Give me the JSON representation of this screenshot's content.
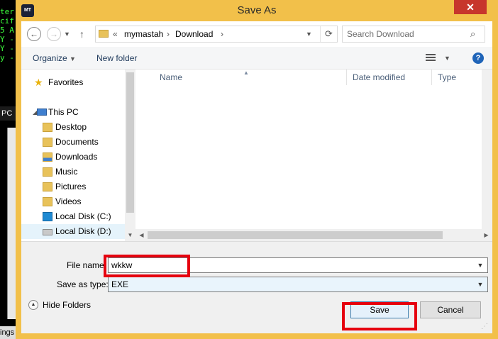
{
  "background": {
    "terminal_lines": [
      "ter",
      "cif",
      "5 A",
      "Y -",
      "Y -",
      "y -"
    ],
    "pc_label": "PC",
    "bottom_label": "ings"
  },
  "dialog": {
    "title": "Save As",
    "app_icon": "MT",
    "close_label": "✕"
  },
  "address": {
    "chevrons": "«",
    "crumbs": [
      "mymastah",
      "Download"
    ],
    "separator": "›"
  },
  "search": {
    "placeholder": "Search Download"
  },
  "toolbar": {
    "organize": "Organize",
    "new_folder": "New folder",
    "help": "?"
  },
  "nav": {
    "favorites": "Favorites",
    "this_pc": "This PC",
    "items": [
      {
        "label": "Desktop",
        "icon": "folder-icon"
      },
      {
        "label": "Documents",
        "icon": "documents-folder-icon"
      },
      {
        "label": "Downloads",
        "icon": "downloads-folder-icon"
      },
      {
        "label": "Music",
        "icon": "music-folder-icon"
      },
      {
        "label": "Pictures",
        "icon": "pictures-folder-icon"
      },
      {
        "label": "Videos",
        "icon": "videos-folder-icon"
      },
      {
        "label": "Local Disk (C:)",
        "icon": "windows-disk-icon"
      },
      {
        "label": "Local Disk (D:)",
        "icon": "disk-icon"
      }
    ],
    "selected": "Local Disk (D:)"
  },
  "columns": [
    "Name",
    "Date modified",
    "Type"
  ],
  "form": {
    "file_name_label": "File name:",
    "file_name_value": "wkkw",
    "save_as_type_label": "Save as type:",
    "save_as_type_value": "EXE"
  },
  "footer": {
    "hide_folders": "Hide Folders",
    "save": "Save",
    "cancel": "Cancel"
  },
  "colors": {
    "window_frame": "#f2c04a",
    "close_button": "#c7362c",
    "highlight": "#e6000e",
    "selection": "#e5f3fb"
  }
}
